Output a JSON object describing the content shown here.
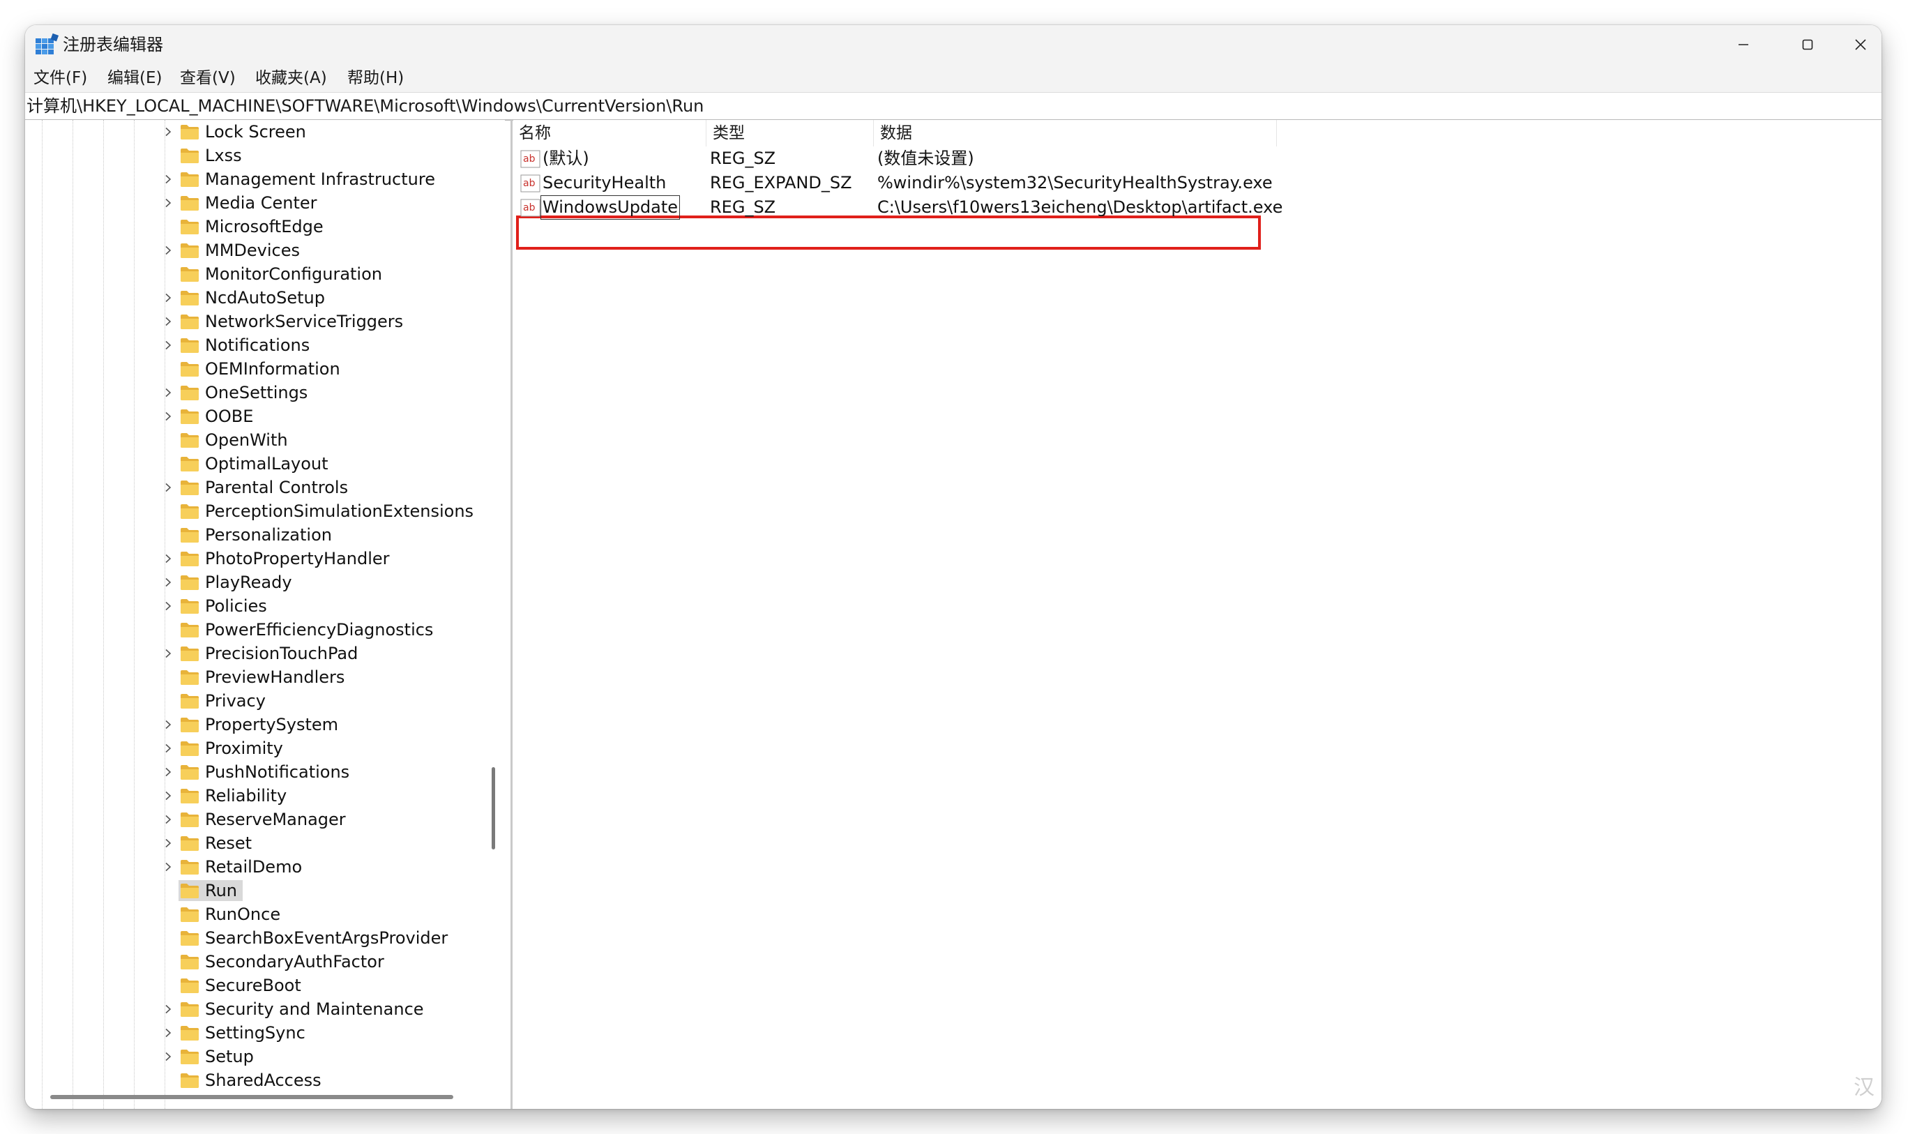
{
  "window": {
    "title": "注册表编辑器",
    "accent": "#e0201b",
    "corner_mark": "汉"
  },
  "menubar": {
    "items": [
      {
        "label": "文件(F)"
      },
      {
        "label": "编辑(E)"
      },
      {
        "label": "查看(V)"
      },
      {
        "label": "收藏夹(A)"
      },
      {
        "label": "帮助(H)"
      }
    ]
  },
  "address": {
    "path": "计算机\\HKEY_LOCAL_MACHINE\\SOFTWARE\\Microsoft\\Windows\\CurrentVersion\\Run"
  },
  "tree": {
    "items": [
      {
        "label": "Lock Screen",
        "expandable": true
      },
      {
        "label": "Lxss",
        "expandable": false
      },
      {
        "label": "Management Infrastructure",
        "expandable": true
      },
      {
        "label": "Media Center",
        "expandable": true
      },
      {
        "label": "MicrosoftEdge",
        "expandable": false
      },
      {
        "label": "MMDevices",
        "expandable": true
      },
      {
        "label": "MonitorConfiguration",
        "expandable": false
      },
      {
        "label": "NcdAutoSetup",
        "expandable": true
      },
      {
        "label": "NetworkServiceTriggers",
        "expandable": true
      },
      {
        "label": "Notifications",
        "expandable": true
      },
      {
        "label": "OEMInformation",
        "expandable": false
      },
      {
        "label": "OneSettings",
        "expandable": true
      },
      {
        "label": "OOBE",
        "expandable": true
      },
      {
        "label": "OpenWith",
        "expandable": false
      },
      {
        "label": "OptimalLayout",
        "expandable": false
      },
      {
        "label": "Parental Controls",
        "expandable": true
      },
      {
        "label": "PerceptionSimulationExtensions",
        "expandable": false
      },
      {
        "label": "Personalization",
        "expandable": false
      },
      {
        "label": "PhotoPropertyHandler",
        "expandable": true
      },
      {
        "label": "PlayReady",
        "expandable": true
      },
      {
        "label": "Policies",
        "expandable": true
      },
      {
        "label": "PowerEfficiencyDiagnostics",
        "expandable": false
      },
      {
        "label": "PrecisionTouchPad",
        "expandable": true
      },
      {
        "label": "PreviewHandlers",
        "expandable": false
      },
      {
        "label": "Privacy",
        "expandable": false
      },
      {
        "label": "PropertySystem",
        "expandable": true
      },
      {
        "label": "Proximity",
        "expandable": true
      },
      {
        "label": "PushNotifications",
        "expandable": true
      },
      {
        "label": "Reliability",
        "expandable": true
      },
      {
        "label": "ReserveManager",
        "expandable": true
      },
      {
        "label": "Reset",
        "expandable": true
      },
      {
        "label": "RetailDemo",
        "expandable": true
      },
      {
        "label": "Run",
        "expandable": false,
        "selected": true
      },
      {
        "label": "RunOnce",
        "expandable": false
      },
      {
        "label": "SearchBoxEventArgsProvider",
        "expandable": false
      },
      {
        "label": "SecondaryAuthFactor",
        "expandable": false
      },
      {
        "label": "SecureBoot",
        "expandable": false
      },
      {
        "label": "Security and Maintenance",
        "expandable": true
      },
      {
        "label": "SettingSync",
        "expandable": true
      },
      {
        "label": "Setup",
        "expandable": true
      },
      {
        "label": "SharedAccess",
        "expandable": false
      }
    ]
  },
  "values": {
    "headers": {
      "name": "名称",
      "type": "类型",
      "data": "数据"
    },
    "rows": [
      {
        "name": "(默认)",
        "type": "REG_SZ",
        "data": "(数值未设置)"
      },
      {
        "name": "SecurityHealth",
        "type": "REG_EXPAND_SZ",
        "data": "%windir%\\system32\\SecurityHealthSystray.exe"
      },
      {
        "name": "WindowsUpdate",
        "type": "REG_SZ",
        "data": "C:\\Users\\f10wers13eicheng\\Desktop\\artifact.exe",
        "focused": true,
        "highlighted": true
      }
    ]
  }
}
